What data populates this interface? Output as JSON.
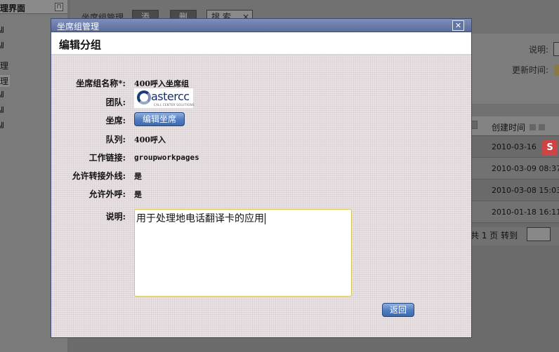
{
  "background": {
    "sidebar_title": "理界面",
    "pin_icon": "pin-icon",
    "nav_items": [
      "理",
      "理",
      "理"
    ],
    "toolbar": {
      "breadcrumb": "坐席组管理",
      "add_label": "添加",
      "delete_label": "删除",
      "search_label": "搜 索",
      "search_clear": "×"
    },
    "filter": {
      "desc_label": "说明:",
      "updated_label": "更新时间:"
    },
    "grid": {
      "created_header": "创建时间",
      "rows": [
        "2010-03-16",
        "2010-03-09 08:37",
        "2010-03-08 15:03",
        "2010-01-18 16:11"
      ]
    },
    "pager": {
      "text": "共 1 页  转到"
    },
    "ime_icon": "S"
  },
  "modal": {
    "window_title": "坐席组管理",
    "close_symbol": "✕",
    "heading": "编辑分组",
    "fields": {
      "name_label": "坐席组名称*:",
      "name_value": "400呼入坐席组",
      "team_label": "团队:",
      "team_logo_text": "astercc",
      "team_logo_tagline": "CALL CENTER SOLUTIONS",
      "agents_label": "坐席:",
      "edit_agents_button": "编辑坐席",
      "queue_label": "队列:",
      "queue_value": "400呼入",
      "worklink_label": "工作链接:",
      "worklink_value": "groupworkpages",
      "allow_transfer_label": "允许转接外线:",
      "allow_transfer_value": "是",
      "allow_outbound_label": "允许外呼:",
      "allow_outbound_value": "是",
      "description_label": "说明:",
      "description_value": "用于处理地电话翻译卡的应用"
    },
    "back_button": "返回"
  }
}
